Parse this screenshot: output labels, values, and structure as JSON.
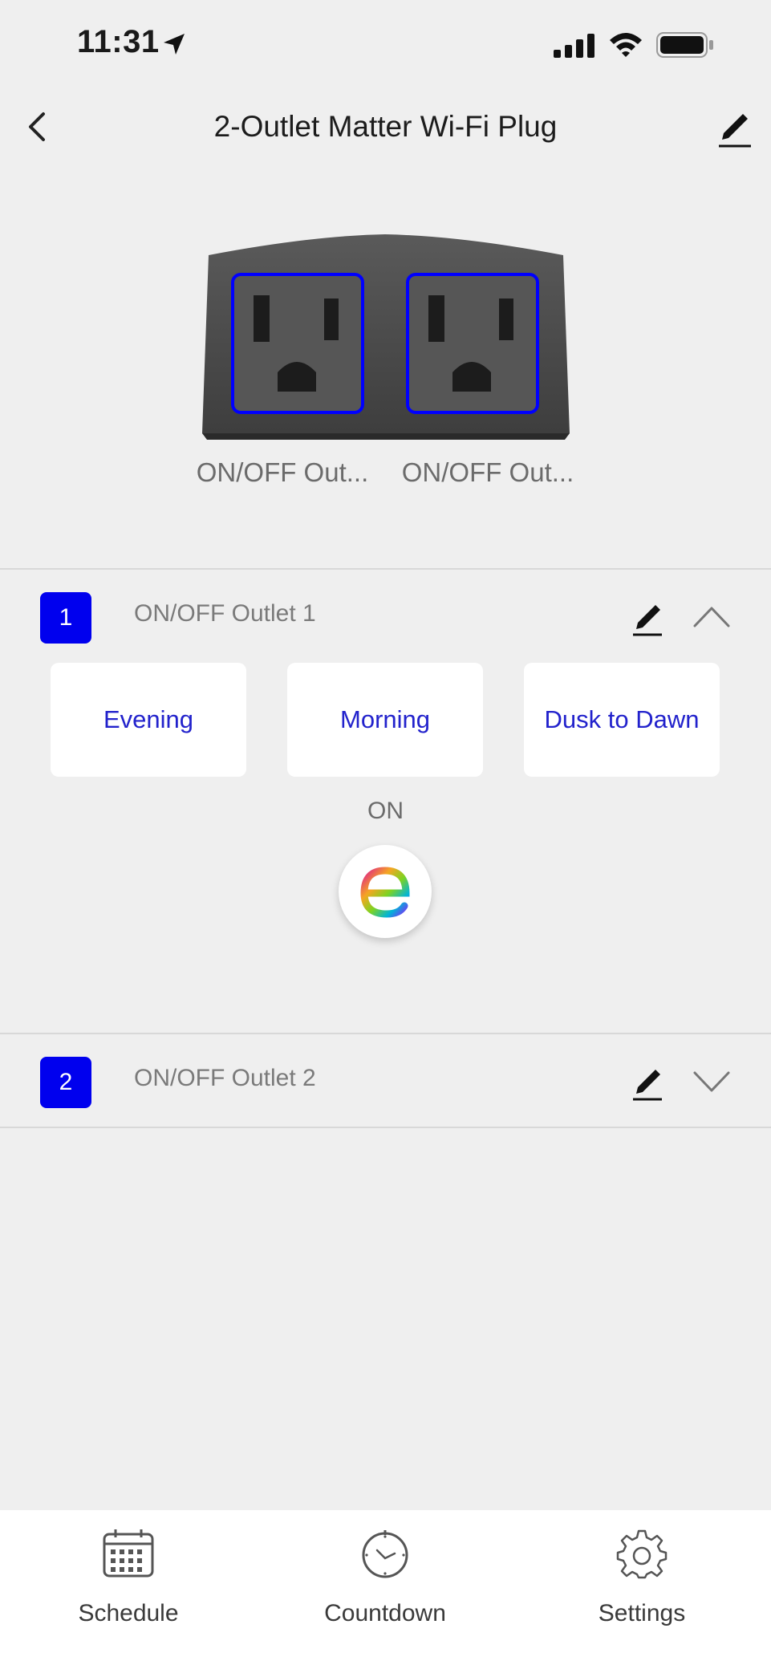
{
  "status_bar": {
    "time": "11:31"
  },
  "header": {
    "title": "2-Outlet Matter Wi-Fi Plug"
  },
  "device": {
    "outlet_labels": [
      "ON/OFF Out...",
      "ON/OFF Out..."
    ]
  },
  "outlets": [
    {
      "number": "1",
      "name": "ON/OFF Outlet 1",
      "expanded": true,
      "scenes": [
        "Evening",
        "Morning",
        "Dusk to Dawn"
      ],
      "state": "ON"
    },
    {
      "number": "2",
      "name": "ON/OFF Outlet 2",
      "expanded": false
    }
  ],
  "tabbar": {
    "tabs": [
      {
        "label": "Schedule",
        "icon": "calendar-icon"
      },
      {
        "label": "Countdown",
        "icon": "clock-icon"
      },
      {
        "label": "Settings",
        "icon": "gear-icon"
      }
    ]
  },
  "colors": {
    "accent_blue": "#0000ee",
    "scene_text": "#2222cc",
    "outlet_highlight": "#0000ff"
  }
}
